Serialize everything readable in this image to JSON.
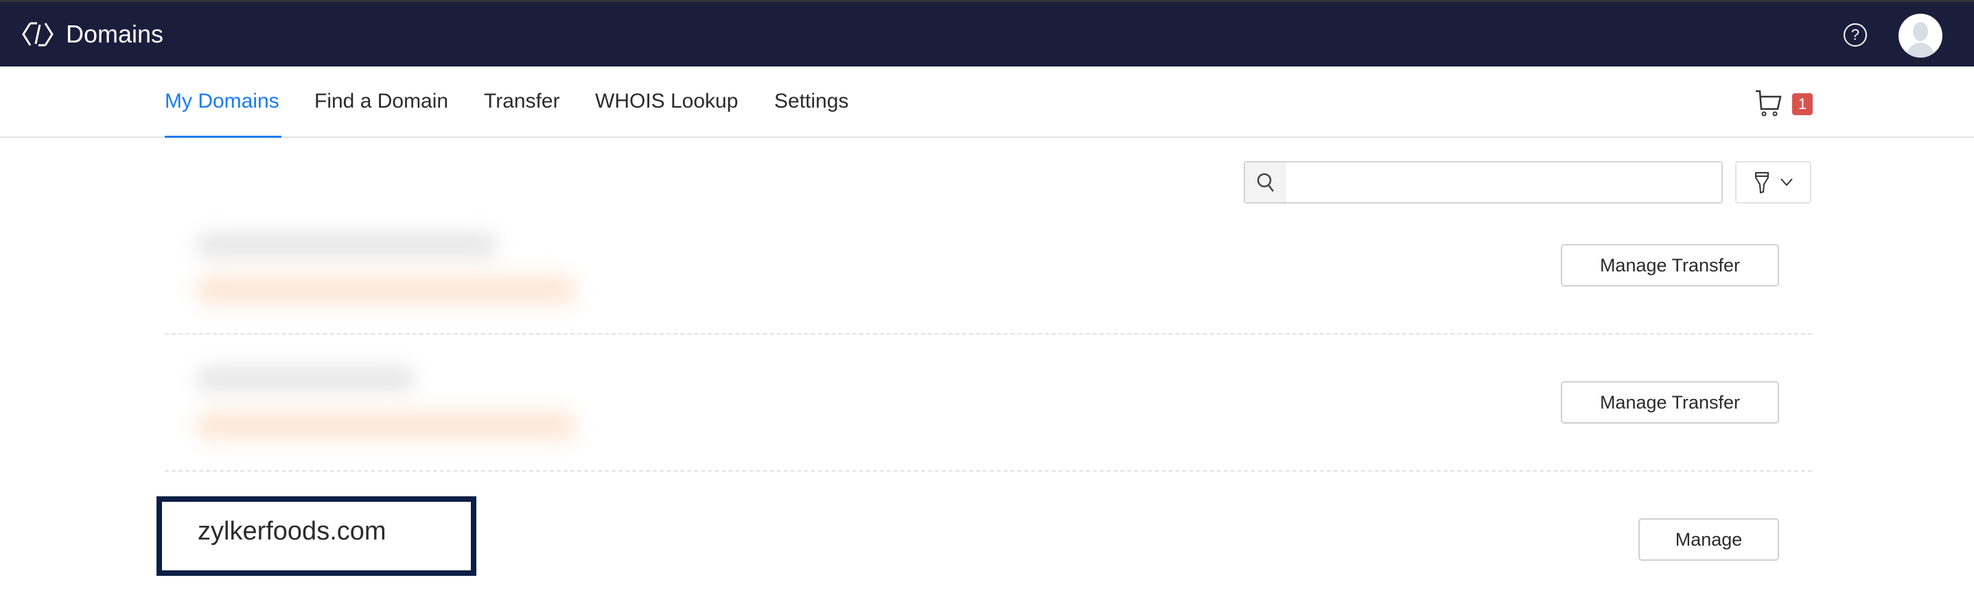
{
  "header": {
    "title": "Domains",
    "help_icon": "help-circle-icon",
    "avatar_icon": "user-avatar-icon"
  },
  "nav": {
    "tabs": [
      {
        "label": "My Domains",
        "active": true
      },
      {
        "label": "Find a Domain"
      },
      {
        "label": "Transfer"
      },
      {
        "label": "WHOIS Lookup"
      },
      {
        "label": "Settings"
      }
    ],
    "cart_count": "1"
  },
  "search": {
    "value": "",
    "placeholder": ""
  },
  "domains": [
    {
      "name": "",
      "action": "Manage Transfer"
    },
    {
      "name": "",
      "action": "Manage Transfer"
    },
    {
      "name": "zylkerfoods.com",
      "action": "Manage"
    }
  ],
  "colors": {
    "header_bg": "#1b1e3b",
    "accent": "#1a7cf0",
    "badge": "#d9534f",
    "highlight": "#0a1f45"
  }
}
